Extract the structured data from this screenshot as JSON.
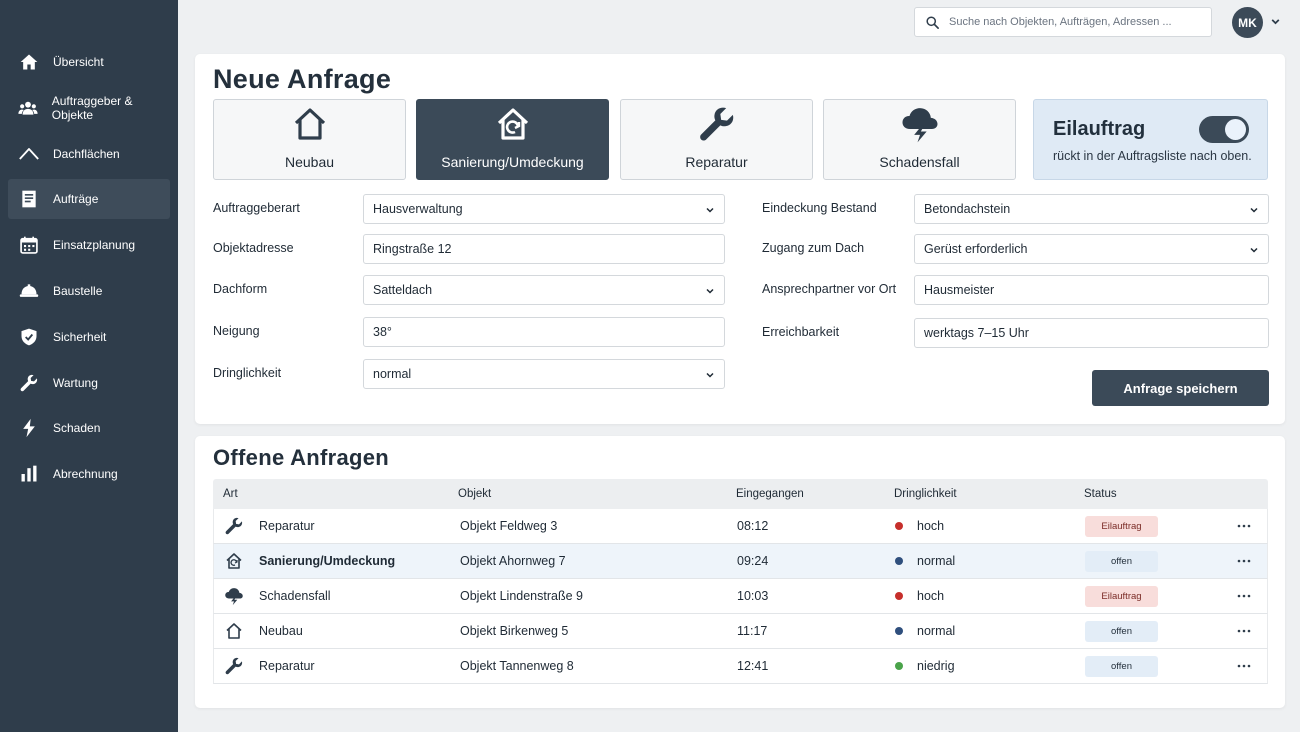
{
  "sidebar": {
    "items": [
      {
        "label": "Übersicht",
        "icon": "home-icon"
      },
      {
        "label": "Auftraggeber & Objekte",
        "icon": "users-icon"
      },
      {
        "label": "Dachflächen",
        "icon": "roof-icon"
      },
      {
        "label": "Aufträge",
        "icon": "document-icon",
        "active": true
      },
      {
        "label": "Einsatzplanung",
        "icon": "calendar-icon"
      },
      {
        "label": "Baustelle",
        "icon": "helmet-icon"
      },
      {
        "label": "Sicherheit",
        "icon": "shield-icon"
      },
      {
        "label": "Wartung",
        "icon": "wrench-icon"
      },
      {
        "label": "Schaden",
        "icon": "lightning-icon"
      },
      {
        "label": "Abrechnung",
        "icon": "bar-chart-icon"
      }
    ]
  },
  "header": {
    "search_placeholder": "Suche nach Objekten, Aufträgen, Adressen ...",
    "avatar_initials": "MK"
  },
  "form": {
    "title": "Neue Anfrage",
    "types": [
      {
        "label": "Neubau",
        "icon": "house-icon",
        "selected": false
      },
      {
        "label": "Sanierung/Umdeckung",
        "icon": "house-renovate-icon",
        "selected": true
      },
      {
        "label": "Reparatur",
        "icon": "wrench-icon",
        "selected": false
      },
      {
        "label": "Schadensfall",
        "icon": "storm-cloud-icon",
        "selected": false
      }
    ],
    "rush": {
      "title": "Eilauftrag",
      "description": "rückt in der Auftragsliste nach oben.",
      "enabled": true
    },
    "left_fields": [
      {
        "label": "Auftraggeberart",
        "value": "Hausverwaltung",
        "type": "select"
      },
      {
        "label": "Objektadresse",
        "value": "Ringstraße 12",
        "type": "text"
      },
      {
        "label": "Dachform",
        "value": "Satteldach",
        "type": "select"
      },
      {
        "label": "Neigung",
        "value": "38°",
        "type": "text"
      },
      {
        "label": "Dringlichkeit",
        "value": "normal",
        "type": "select"
      }
    ],
    "right_fields": [
      {
        "label": "Eindeckung Bestand",
        "value": "Betondachstein",
        "type": "select"
      },
      {
        "label": "Zugang zum Dach",
        "value": "Gerüst erforderlich",
        "type": "select"
      },
      {
        "label": "Ansprechpartner vor Ort",
        "value": "Hausmeister",
        "type": "text"
      },
      {
        "label": "Erreichbarkeit",
        "value": "werktags 7–15 Uhr",
        "type": "text"
      }
    ],
    "save_label": "Anfrage speichern"
  },
  "list": {
    "title": "Offene Anfragen",
    "columns": [
      "Art",
      "Objekt",
      "Eingegangen",
      "Dringlichkeit",
      "Status"
    ],
    "rows": [
      {
        "art": "Reparatur",
        "icon": "wrench-icon",
        "objekt": "Objekt Feldweg 3",
        "time": "08:12",
        "urgency": "hoch",
        "urgency_color": "#c62f2b",
        "status": "Eilauftrag",
        "status_kind": "rush",
        "highlight": false
      },
      {
        "art": "Sanierung/Umdeckung",
        "icon": "house-renovate-icon",
        "objekt": "Objekt Ahornweg 7",
        "time": "09:24",
        "urgency": "normal",
        "urgency_color": "#2f4f7d",
        "status": "offen",
        "status_kind": "open",
        "highlight": true
      },
      {
        "art": "Schadensfall",
        "icon": "storm-cloud-icon",
        "objekt": "Objekt Lindenstraße 9",
        "time": "10:03",
        "urgency": "hoch",
        "urgency_color": "#c62f2b",
        "status": "Eilauftrag",
        "status_kind": "rush",
        "highlight": false
      },
      {
        "art": "Neubau",
        "icon": "house-icon",
        "objekt": "Objekt Birkenweg 5",
        "time": "11:17",
        "urgency": "normal",
        "urgency_color": "#2f4f7d",
        "status": "offen",
        "status_kind": "open",
        "highlight": false
      },
      {
        "art": "Reparatur",
        "icon": "wrench-icon",
        "objekt": "Objekt Tannenweg 8",
        "time": "12:41",
        "urgency": "niedrig",
        "urgency_color": "#4aa34a",
        "status": "offen",
        "status_kind": "open",
        "highlight": false
      }
    ]
  }
}
